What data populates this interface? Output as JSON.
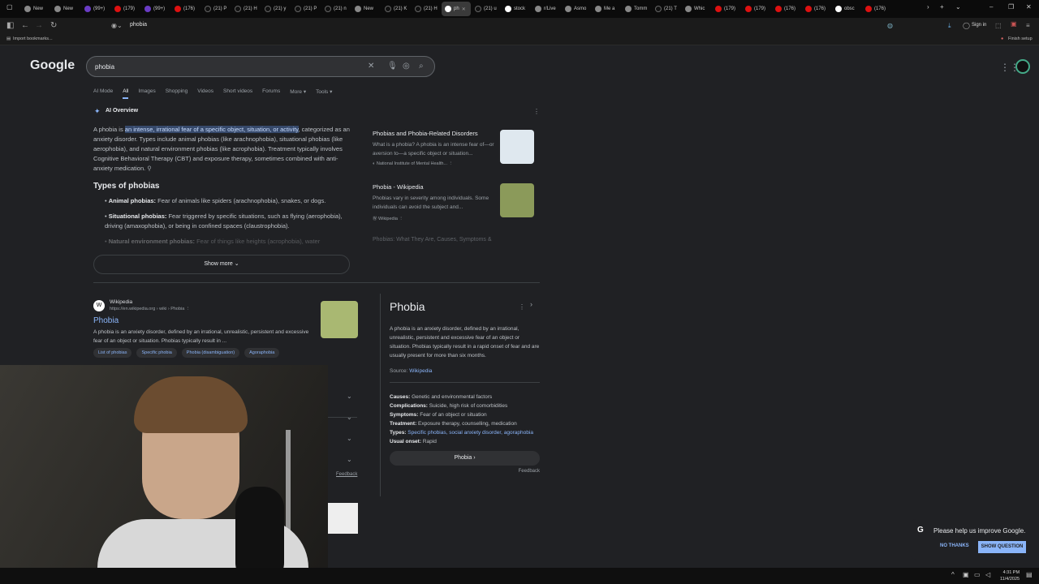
{
  "browser": {
    "tabs": [
      "New",
      "New",
      "(99+)",
      "(179)",
      "(99+)",
      "(176)",
      "(21) P",
      "(21) H",
      "(21) y",
      "(21) P",
      "(21) n",
      "New",
      "(21) K",
      "(21) H",
      "ph",
      "(21) u",
      "stock",
      "r/Live",
      "Asmo",
      "Me a",
      "Tomm",
      "(21) T",
      "Whic",
      "(179)",
      "(179)",
      "(176)",
      "(176)",
      "obsc",
      "(176)"
    ],
    "address": "phobia",
    "sign_in": "Sign in",
    "import_bookmarks": "Import bookmarks...",
    "finish_setup": "Finish setup"
  },
  "google": {
    "logo": "Google",
    "query": "phobia",
    "filters": [
      "AI Mode",
      "Images",
      "Shopping",
      "Videos",
      "Short videos",
      "Forums",
      "More ▾",
      "Tools ▾"
    ],
    "active_filter": "All"
  },
  "ai_overview": {
    "label": "AI Overview",
    "intro_pre": "A phobia is ",
    "intro_highlight": "an intense, irrational fear of a specific object, situation, or activity",
    "intro_post": ", categorized as an anxiety disorder. Types include animal phobias (like arachnophobia), situational phobias (like aerophobia), and natural environment phobias (like acrophobia). Treatment typically involves Cognitive Behavioral Therapy (CBT) and exposure therapy, sometimes combined with anti-anxiety medication.",
    "types_heading": "Types of phobias",
    "bullets": [
      {
        "bold": "Animal phobias:",
        "text": " Fear of animals like spiders (arachnophobia), snakes, or dogs."
      },
      {
        "bold": "Situational phobias:",
        "text": " Fear triggered by specific situations, such as flying (aerophobia), driving (amaxophobia), or being in confined spaces (claustrophobia)."
      },
      {
        "bold": "Natural environment phobias:",
        "text": " Fear of things like heights (acrophobia), water"
      }
    ],
    "show_more": "Show more",
    "sources": [
      {
        "title": "Phobias and Phobia-Related Disorders",
        "snippet": "What is a phobia? A phobia is an intense fear of—or aversion to—a specific object or situation...",
        "site": "National Institute of Mental Health..."
      },
      {
        "title": "Phobia - Wikipedia",
        "snippet": "Phobias vary in severity among individuals. Some individuals can avoid the subject and...",
        "site": "Wikipedia"
      }
    ],
    "faded_source": "Phobias: What They Are, Causes, Symptoms &"
  },
  "result": {
    "site": "Wikipedia",
    "url": "https://en.wikipedia.org › wiki › Phobia",
    "title": "Phobia",
    "snippet": "A phobia is an anxiety disorder, defined by an irrational, unrealistic, persistent and excessive fear of an object or situation. Phobias typically result in ...",
    "chips": [
      "List of phobias",
      "Specific phobia",
      "Phobia (disambiguation)",
      "Agoraphobia"
    ],
    "feedback": "Feedback"
  },
  "knowledge_panel": {
    "title": "Phobia",
    "description": "A phobia is an anxiety disorder, defined by an irrational, unrealistic, persistent and excessive fear of an object or situation. Phobias typically result in a rapid onset of fear and are usually present for more than six months.",
    "source_label": "Source:",
    "source_link": "Wikipedia",
    "facts": [
      {
        "label": "Causes:",
        "value": "Genetic and environmental factors"
      },
      {
        "label": "Complications:",
        "value": "Suicide, high risk of comorbidities"
      },
      {
        "label": "Symptoms:",
        "value": "Fear of an object or situation"
      },
      {
        "label": "Treatment:",
        "value": "Exposure therapy, counselling, medication"
      },
      {
        "label": "Types:",
        "value": "Specific phobias, social anxiety disorder, agoraphobia"
      },
      {
        "label": "Usual onset:",
        "value": "Rapid"
      }
    ],
    "button": "Phobia",
    "feedback": "Feedback"
  },
  "popup": {
    "text": "Please help us improve Google.",
    "no": "NO THANKS",
    "yes": "SHOW QUESTION"
  },
  "taskbar": {
    "time": "4:31 PM",
    "date": "11/4/2025"
  }
}
